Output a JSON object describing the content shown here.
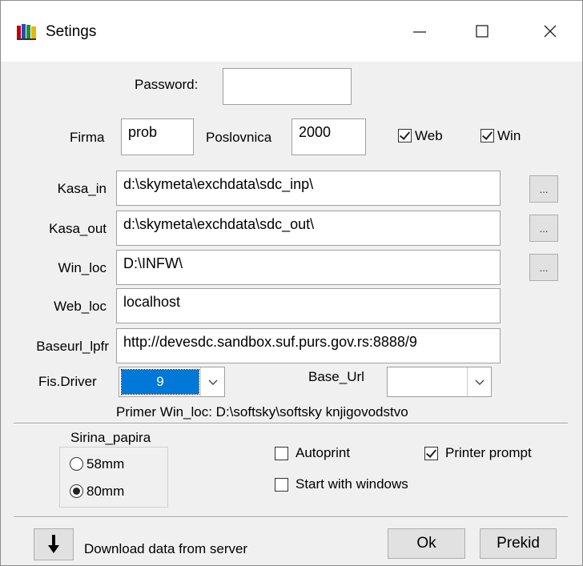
{
  "window": {
    "title": "Setings",
    "icon": "app-icon"
  },
  "titlebar_buttons": {
    "minimize": "minimize-icon",
    "maximize": "maximize-icon",
    "close": "close-icon"
  },
  "password": {
    "label": "Password:",
    "value": ""
  },
  "firma": {
    "label": "Firma",
    "value": "prob"
  },
  "poslovnica": {
    "label": "Poslovnica",
    "value": "2000"
  },
  "web_check": {
    "label": "Web",
    "checked": true
  },
  "win_check": {
    "label": "Win",
    "checked": true
  },
  "kasa_in": {
    "label": "Kasa_in",
    "value": "d:\\skymeta\\exchdata\\sdc_inp\\"
  },
  "kasa_out": {
    "label": "Kasa_out",
    "value": "d:\\skymeta\\exchdata\\sdc_out\\"
  },
  "win_loc": {
    "label": "Win_loc",
    "value": "D:\\INFW\\"
  },
  "web_loc": {
    "label": "Web_loc",
    "value": "localhost"
  },
  "baseurl_lpfr": {
    "label": "Baseurl_lpfr",
    "value": "http://devesdc.sandbox.suf.purs.gov.rs:8888/9"
  },
  "browse_label": "...",
  "fis_driver": {
    "label": "Fis.Driver",
    "value": "9"
  },
  "base_url": {
    "label": "Base_Url",
    "value": ""
  },
  "hint": "Primer Win_loc: D:\\softsky\\softsky knjigovodstvo",
  "sirina_papira": {
    "label": "Sirina_papira",
    "options": [
      {
        "label": "58mm",
        "checked": false
      },
      {
        "label": "80mm",
        "checked": true
      }
    ]
  },
  "autoprint": {
    "label": "Autoprint",
    "checked": false
  },
  "printer_prompt": {
    "label": "Printer prompt",
    "checked": true
  },
  "start_with_windows": {
    "label": "Start with windows",
    "checked": false
  },
  "download": {
    "label": "Download data from server",
    "icon": "down-arrow-icon"
  },
  "ok_button": {
    "label": "Ok"
  },
  "prekid_button": {
    "label": "Prekid"
  },
  "colors": {
    "selection": "#0078d7",
    "window_bg": "#f0f0f0"
  }
}
